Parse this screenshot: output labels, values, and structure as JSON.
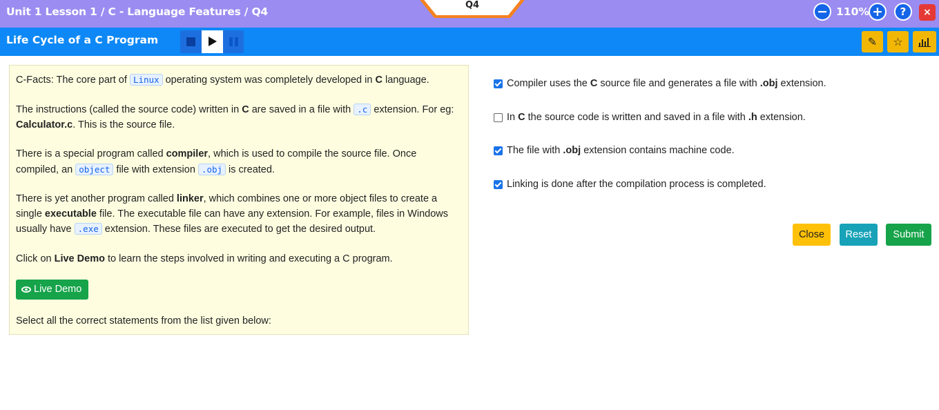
{
  "header": {
    "breadcrumb": "Unit 1 Lesson 1 / C - Language Features / Q4",
    "question_tab": "Q4",
    "zoom": "110%",
    "zoom_out_label": "−",
    "zoom_in_label": "+",
    "help_label": "?",
    "close_label": "×"
  },
  "titlebar": {
    "title": "Life Cycle of a C Program",
    "tools": [
      {
        "name": "pencil-icon",
        "glyph": "✎"
      },
      {
        "name": "star-icon",
        "glyph": "☆"
      },
      {
        "name": "bar-chart-icon",
        "glyph": "📊"
      }
    ]
  },
  "content": {
    "p1": {
      "a": "C-Facts: The core part of ",
      "code": "Linux",
      "b": " operating system was completely developed in ",
      "bold": "C",
      "c": " language."
    },
    "p2": {
      "a": "The instructions (called the source code) written in ",
      "bold1": "C",
      "b": " are saved in a file with ",
      "code": ".c",
      "c": " extension. For eg:",
      "bold2": "Calculator.c",
      "d": ". This is the source file."
    },
    "p3": {
      "a": "There is a special program called ",
      "bold": "compiler",
      "b": ", which is used to compile the source file. Once",
      "c": "compiled, an ",
      "code1": "object",
      "d": " file with extension ",
      "code2": ".obj",
      "e": " is created."
    },
    "p4": {
      "a": "There is yet another program called ",
      "bold1": "linker",
      "b": ", which combines one or more object files to create a",
      "c": "single ",
      "bold2": "executable",
      "d": " file. The executable file can have any extension. For example, files in Windows",
      "e": "usually have ",
      "code": ".exe",
      "f": " extension. These files are executed to get the desired output."
    },
    "p5": {
      "a": "Click on ",
      "bold": "Live Demo",
      "b": " to learn the steps involved in writing and executing a C program."
    },
    "live_demo_label": "Live Demo",
    "instruction": "Select all the correct statements from the list given below:"
  },
  "options": [
    {
      "checked": true,
      "a": "Compiler uses the ",
      "b1": "C",
      "b": " source file and generates a file with ",
      "b2": ".obj",
      "c": " extension."
    },
    {
      "checked": false,
      "a": "In ",
      "b1": "C",
      "b": " the source code is written and saved in a file with ",
      "b2": ".h",
      "c": " extension."
    },
    {
      "checked": true,
      "a": "The file with ",
      "b1": ".obj",
      "b": " extension contains machine code.",
      "b2": "",
      "c": ""
    },
    {
      "checked": true,
      "a": "Linking is done after the compilation process is completed.",
      "b1": "",
      "b": "",
      "b2": "",
      "c": ""
    }
  ],
  "actions": {
    "close_label": "Close",
    "reset_label": "Reset",
    "submit_label": "Submit",
    "colors": {
      "close": "#ffc107",
      "reset": "#17a2b8",
      "submit": "#16a34a"
    }
  }
}
